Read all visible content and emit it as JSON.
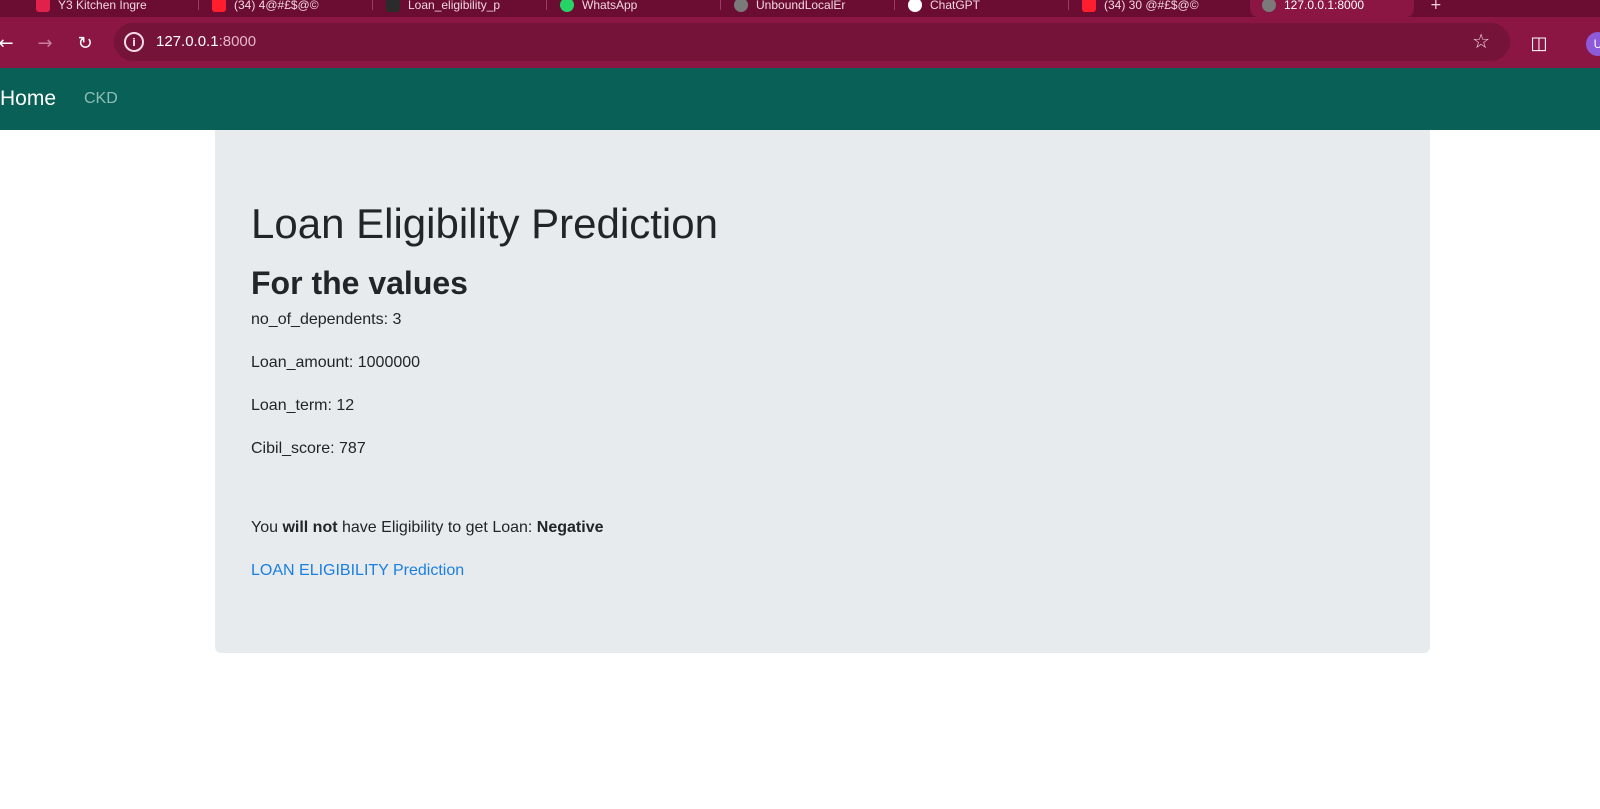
{
  "browser": {
    "tabs": [
      {
        "label": "Y3 Kitchen Ingre",
        "color": "#e0214a"
      },
      {
        "label": "(34) 4@#£$@©",
        "color": "#ff1e2d"
      },
      {
        "label": "Loan_eligibility_p",
        "color": "#2b2b2b"
      },
      {
        "label": "WhatsApp",
        "color": "#25d366"
      },
      {
        "label": "UnboundLocalEr",
        "color": "#7a7a7a"
      },
      {
        "label": "ChatGPT",
        "color": "#ffffff"
      },
      {
        "label": "(34) 30 @#£$@©",
        "color": "#ff1e2d"
      },
      {
        "label": "127.0.0.1:8000",
        "color": "#7a7a7a"
      }
    ],
    "url_host": "127.0.0.1",
    "url_port": ":8000",
    "profile_initial": "U"
  },
  "navbar": {
    "brand": "Home",
    "link": "CKD"
  },
  "main": {
    "title": "Loan Eligibility Prediction",
    "subtitle": "For the values",
    "values": [
      "no_of_dependents: 3",
      "Loan_amount: 1000000",
      "Loan_term: 12",
      "Cibil_score: 787"
    ],
    "result_prefix": "You ",
    "result_emphasis": "will not",
    "result_middle": " have Eligibility to get Loan: ",
    "result_value": "Negative",
    "back_link": "LOAN ELIGIBILITY Prediction"
  },
  "colors": {
    "browser_frame": "#8b1644",
    "navbar": "#086056",
    "card": "#e8ebee",
    "link": "#1a7fe0"
  }
}
